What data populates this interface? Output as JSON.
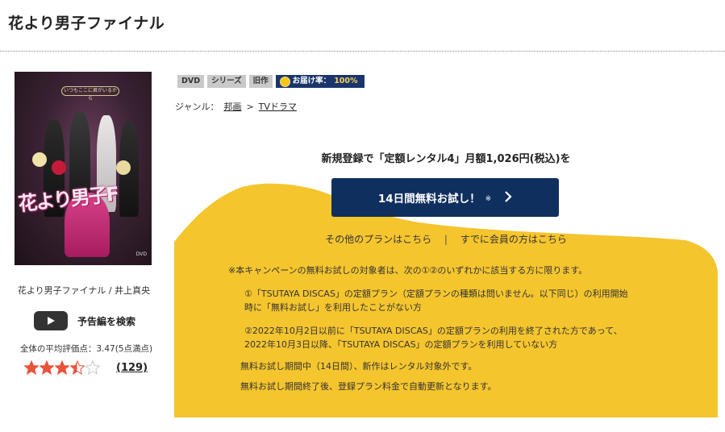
{
  "page": {
    "title": "花より男子ファイナル"
  },
  "poster": {
    "logo_text": "花より男子F",
    "tagline": "いつもここに君がいるから",
    "disc_mark": "DVD"
  },
  "movie_caption": "花より男子ファイナル / 井上真央",
  "trailer": {
    "label": "予告編を検索",
    "icon": "play-icon"
  },
  "rating": {
    "text": "全体の平均評価点：3.47(5点満点)",
    "score": 3.47,
    "max": 5,
    "review_count": "(129)",
    "star_color": "#e8543a"
  },
  "badges": [
    "DVD",
    "シリーズ",
    "旧作"
  ],
  "delivery": {
    "label": "お届け率：",
    "rate": "100%"
  },
  "genre": {
    "label": "ジャンル：",
    "items": [
      "邦画",
      "TVドラマ"
    ],
    "separator": ">"
  },
  "promo": {
    "headline": "新規登録で「定額レンタル4」月額1,026円(税込)を",
    "cta_label": "14日間無料お試し！",
    "cta_note": "※",
    "cta_color": "#0f2f5f",
    "yellow": "#f5c52e",
    "other_plans": "その他のプランはこちら",
    "separator": "|",
    "members": "すでに会員の方はこちら"
  },
  "notes": {
    "n1": "※本キャンペーンの無料お試しの対象者は、次の①②のいずれかに該当する方に限ります。",
    "n2a": "①「TSUTAYA DISCAS」の定額プラン（定額プランの種類は問いません。以下同じ）の利用開始",
    "n2b": "時に「無料お試し」を利用したことがない方",
    "n3a": "②2022年10月2日以前に「TSUTAYA DISCAS」の定額プランの利用を終了された方であって、",
    "n3b": "2022年10月3日以降、「TSUTAYA DISCAS」の定額プランを利用していない方",
    "n4": "無料お試し期間中（14日間）、新作はレンタル対象外です。",
    "n5": "無料お試し期間終了後、登録プラン料金で自動更新となります。"
  }
}
